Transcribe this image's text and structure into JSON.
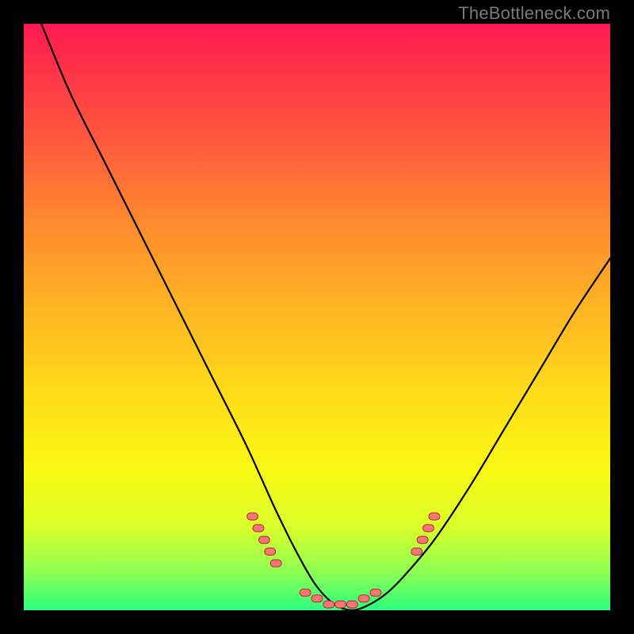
{
  "watermark": "TheBottleneck.com",
  "chart_data": {
    "type": "line",
    "title": "",
    "xlabel": "",
    "ylabel": "",
    "xlim": [
      0,
      100
    ],
    "ylim": [
      0,
      100
    ],
    "grid": false,
    "series": [
      {
        "name": "bottleneck-curve",
        "color": "#000000",
        "x": [
          3,
          8,
          14,
          20,
          26,
          32,
          38,
          43,
          47,
          50,
          53,
          56,
          59,
          62,
          65,
          70,
          76,
          82,
          88,
          94,
          100
        ],
        "y": [
          100,
          88,
          76,
          64,
          52,
          40,
          28,
          17,
          9,
          4,
          1,
          0,
          1,
          3,
          6,
          12,
          21,
          31,
          41,
          51,
          60
        ]
      }
    ],
    "markers": {
      "name": "sample-points",
      "color_fill": "#f07878",
      "color_stroke": "#c02020",
      "shape": "rounded-rect",
      "points": [
        {
          "x": 39,
          "y": 16
        },
        {
          "x": 40,
          "y": 14
        },
        {
          "x": 41,
          "y": 12
        },
        {
          "x": 42,
          "y": 10
        },
        {
          "x": 43,
          "y": 8
        },
        {
          "x": 48,
          "y": 3
        },
        {
          "x": 50,
          "y": 2
        },
        {
          "x": 52,
          "y": 1
        },
        {
          "x": 54,
          "y": 1
        },
        {
          "x": 56,
          "y": 1
        },
        {
          "x": 58,
          "y": 2
        },
        {
          "x": 60,
          "y": 3
        },
        {
          "x": 67,
          "y": 10
        },
        {
          "x": 68,
          "y": 12
        },
        {
          "x": 69,
          "y": 14
        },
        {
          "x": 70,
          "y": 16
        }
      ]
    },
    "background_gradient": {
      "top": "#ff1a52",
      "bottom": "#2bff7d"
    }
  }
}
